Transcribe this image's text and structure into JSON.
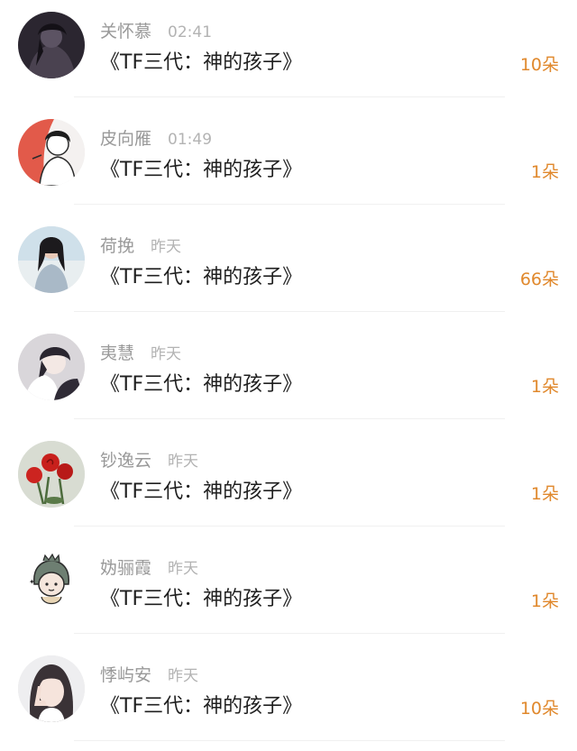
{
  "colors": {
    "count_accent": "#e0882c",
    "name_text": "#999999",
    "time_text": "#b3b3b3",
    "title_text": "#1f1f1f"
  },
  "items": [
    {
      "name": "关怀慕",
      "time": "02:41",
      "title": "《TF三代：神的孩子》",
      "count": "10朵",
      "avatar": "avatar-dark-figure"
    },
    {
      "name": "皮向雁",
      "time": "01:49",
      "title": "《TF三代：神的孩子》",
      "count": "1朵",
      "avatar": "avatar-sketch-boy"
    },
    {
      "name": "荷挽",
      "time": "昨天",
      "title": "《TF三代：神的孩子》",
      "count": "66朵",
      "avatar": "avatar-girl-beach"
    },
    {
      "name": "夷慧",
      "time": "昨天",
      "title": "《TF三代：神的孩子》",
      "count": "1朵",
      "avatar": "avatar-anime-pair"
    },
    {
      "name": "钞逸云",
      "time": "昨天",
      "title": "《TF三代：神的孩子》",
      "count": "1朵",
      "avatar": "avatar-red-roses"
    },
    {
      "name": "妫骊霞",
      "time": "昨天",
      "title": "《TF三代：神的孩子》",
      "count": "1朵",
      "avatar": "avatar-dino-hood"
    },
    {
      "name": "悸屿安",
      "time": "昨天",
      "title": "《TF三代：神的孩子》",
      "count": "10朵",
      "avatar": "avatar-girl-peace"
    }
  ]
}
